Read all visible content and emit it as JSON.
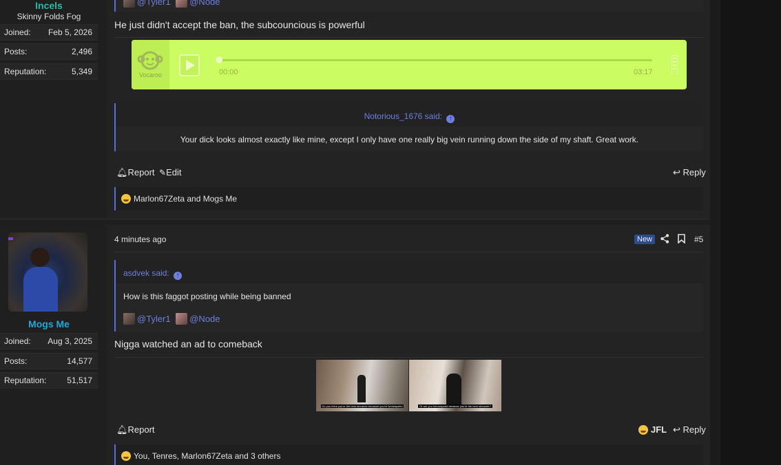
{
  "post1": {
    "user": {
      "name": "Incels",
      "title": "Skinny Folds Fog",
      "stats": [
        {
          "label": "Joined:",
          "value": "Feb 5, 2026"
        },
        {
          "label": "Posts:",
          "value": "2,496"
        },
        {
          "label": "Reputation:",
          "value": "5,349"
        }
      ]
    },
    "top_mentions": [
      "@Tyler1",
      "@Node"
    ],
    "message": "He just didn't accept the ban, the subcouncious is powerful",
    "vocaroo": {
      "brand": "Vocaroo",
      "current_time": "00:00",
      "duration": "03:17",
      "progress": 0,
      "color": "#cbfc61"
    },
    "quote": {
      "author_text": "Notorious_1676 said:",
      "text": "Your dick looks almost exactly like mine, except I only have one really big vein running down the side of my shaft. Great work."
    },
    "actions": {
      "report": "Report",
      "edit": "Edit",
      "reply": "Reply"
    },
    "reactions": "Marlon67Zeta and Mogs Me"
  },
  "post2": {
    "user": {
      "name": "Mogs Me",
      "stats": [
        {
          "label": "Joined:",
          "value": "Aug 3, 2025"
        },
        {
          "label": "Posts:",
          "value": "14,577"
        },
        {
          "label": "Reputation:",
          "value": "51,517"
        }
      ]
    },
    "time": "4 minutes ago",
    "badge": "New",
    "number": "#5",
    "quote": {
      "author_text": "asdvek said:",
      "text": "How is this faggot posting while being banned",
      "mentions": [
        "@Tyler1",
        "@Node"
      ]
    },
    "message": "Nigga watched an ad to comeback",
    "images": [
      {
        "caption": "Do you think you're the best streamer because you're Ishowspeed"
      },
      {
        "caption": "Or are you Ishowspeed because you're the best streamer?"
      }
    ],
    "actions": {
      "report": "Report",
      "react": "JFL",
      "reply": "Reply"
    },
    "reactions": "You, Tenres, Marlon67Zeta and 3 others"
  }
}
